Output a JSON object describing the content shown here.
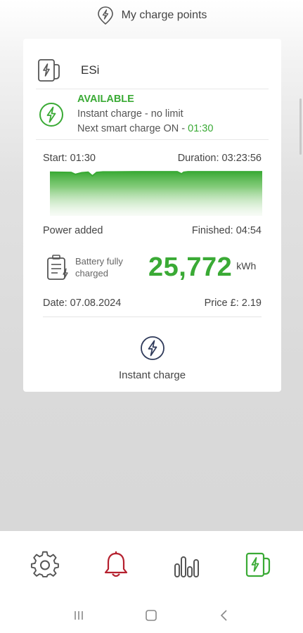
{
  "header": {
    "title": "My charge points",
    "icon": "location-bolt-icon"
  },
  "card": {
    "charger_name": "ESi",
    "charger_icon": "charger-station-icon",
    "status": {
      "label": "AVAILABLE",
      "mode": "Instant charge - no limit",
      "next_smart_prefix": "Next smart charge ON - ",
      "next_smart_time": "01:30",
      "icon": "bolt-circle-icon"
    },
    "session": {
      "start_label": "Start: 01:30",
      "duration_label": "Duration: 03:23:56",
      "power_added_label": "Power added",
      "finished_label": "Finished: 04:54",
      "battery_text": "Battery fully charged",
      "energy_value": "25,772",
      "energy_unit": "kWh",
      "date_label": "Date: 07.08.2024",
      "price_label": "Price £: 2.19"
    },
    "instant_charge_label": "Instant charge"
  },
  "chart_data": {
    "type": "area",
    "x": [
      0,
      0.1,
      0.12,
      0.15,
      0.18,
      0.2,
      0.22,
      0.25,
      0.3,
      0.4,
      0.5,
      0.6,
      0.62,
      0.63,
      0.65,
      0.7,
      0.8,
      0.9,
      1.0
    ],
    "values": [
      0.95,
      0.94,
      0.86,
      0.93,
      0.95,
      0.8,
      0.94,
      0.96,
      0.96,
      0.97,
      0.97,
      0.97,
      0.88,
      0.95,
      0.97,
      0.97,
      0.97,
      0.97,
      0.97
    ],
    "ylim": [
      0,
      1
    ],
    "grid": false,
    "color": "#3aaa35"
  },
  "tabbar": {
    "items": [
      {
        "name": "settings",
        "icon": "gear-icon",
        "color": "#555555"
      },
      {
        "name": "notifications",
        "icon": "bell-icon",
        "color": "#b5202e"
      },
      {
        "name": "statistics",
        "icon": "bar-chart-icon",
        "color": "#555555"
      },
      {
        "name": "charge-points",
        "icon": "charger-station-icon",
        "color": "#3aaa35"
      }
    ]
  },
  "system_nav": {
    "items": [
      "recents-icon",
      "home-icon",
      "back-icon"
    ]
  }
}
